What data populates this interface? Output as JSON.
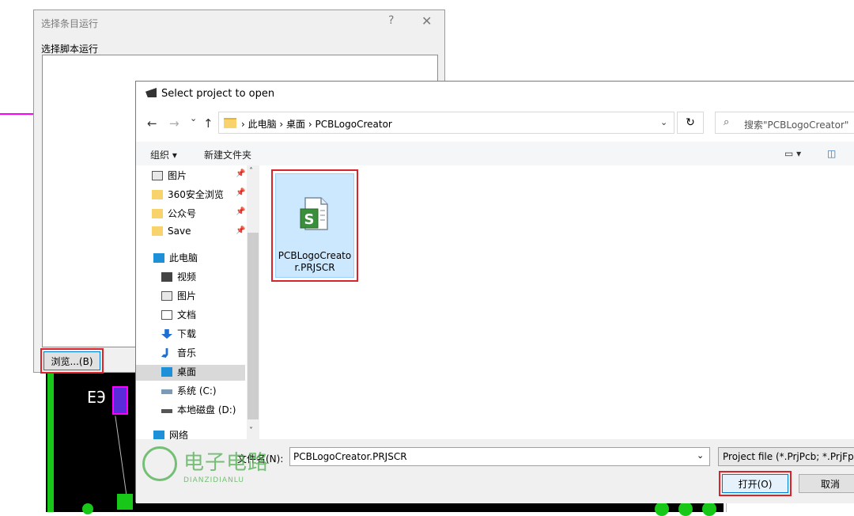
{
  "run_dialog": {
    "title": "选择条目运行",
    "help": "?",
    "close": "✕",
    "label": "选择脚本运行",
    "browse_button": "浏览...(B)"
  },
  "open_dialog": {
    "title": "Select project to open",
    "nav": {
      "back": "←",
      "forward": "→",
      "recent": "⌄",
      "up": "↑",
      "address": "›  此电脑  ›  桌面  ›  PCBLogoCreator",
      "address_dropdown": "⌄",
      "refresh": "↻",
      "search_placeholder": "搜索\"PCBLogoCreator\"",
      "search_icon": "⌕"
    },
    "command_bar": {
      "organize": "组织 ▾",
      "new_folder": "新建文件夹",
      "view": "▭ ▾",
      "preview": "◫"
    },
    "nav_items": [
      {
        "label": "图片",
        "pinned": true
      },
      {
        "label": "360安全浏览",
        "pinned": true
      },
      {
        "label": "公众号",
        "pinned": true
      },
      {
        "label": "Save",
        "pinned": true
      },
      {
        "label": "此电脑",
        "pinned": false
      },
      {
        "label": "视频",
        "pinned": false
      },
      {
        "label": "图片",
        "pinned": false
      },
      {
        "label": "文档",
        "pinned": false
      },
      {
        "label": "下载",
        "pinned": false
      },
      {
        "label": "音乐",
        "pinned": false
      },
      {
        "label": "桌面",
        "pinned": false,
        "selected": true
      },
      {
        "label": "系统 (C:)",
        "pinned": false
      },
      {
        "label": "本地磁盘 (D:)",
        "pinned": false
      },
      {
        "label": "网络",
        "pinned": false
      }
    ],
    "pin_glyph": "📌",
    "scroll_up": "˄",
    "scroll_down": "˅",
    "file": {
      "name_line1": "PCBLogoCreato",
      "name_line2": "r.PRJSCR"
    },
    "filename_label": "文件名(N):",
    "filename_value": "PCBLogoCreator.PRJSCR",
    "filename_dropdown": "⌄",
    "filetype": "Project file (*.PrjPcb; *.PrjFpg",
    "open_button": "打开(O)",
    "cancel_button": "取消"
  },
  "pcb": {
    "label": "ЕЭ"
  },
  "watermark": {
    "text": "电子电路",
    "sub": "DIANZIDIANLU"
  },
  "colors": {
    "accent": "#0078d7",
    "highlight": "#d9242b",
    "pcb_green": "#18c818",
    "selection": "#cce8ff"
  }
}
